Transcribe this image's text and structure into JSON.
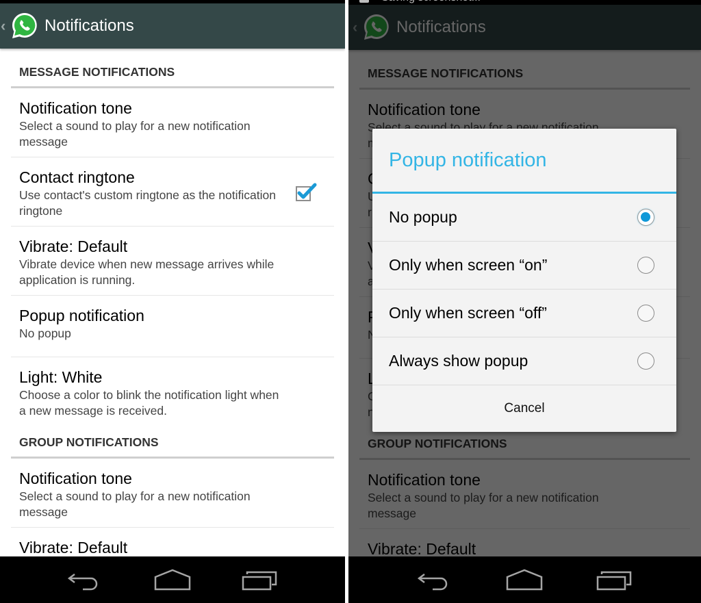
{
  "left": {
    "actionbar": {
      "title": "Notifications",
      "up_icon": "chevron-left-icon",
      "logo_icon": "whatsapp-logo-icon"
    },
    "categories": [
      {
        "title": "MESSAGE NOTIFICATIONS",
        "items": [
          {
            "title": "Notification tone",
            "summary": "Select a sound to play for a new notification message"
          },
          {
            "title": "Contact ringtone",
            "summary": "Use contact's custom ringtone as the notification ringtone",
            "checked": true
          },
          {
            "title": "Vibrate: Default",
            "summary": "Vibrate device when new message arrives while application is running."
          },
          {
            "title": "Popup notification",
            "summary": "No popup"
          },
          {
            "title": "Light: White",
            "summary": "Choose a color to blink the notification light when a new message is received."
          }
        ]
      },
      {
        "title": "GROUP NOTIFICATIONS",
        "items": [
          {
            "title": "Notification tone",
            "summary": "Select a sound to play for a new notification message"
          },
          {
            "title": "Vibrate: Default",
            "summary": ""
          }
        ]
      }
    ]
  },
  "right": {
    "statusbar": {
      "text": "Saving screenshot..."
    },
    "actionbar": {
      "title": "Notifications"
    },
    "categories": [
      {
        "title": "MESSAGE NOTIFICATIONS",
        "items": [
          {
            "title": "Notification tone",
            "summary": "Select a sound to play for a new notification message"
          },
          {
            "title": "Contact ringtone",
            "summary": "Use contact's custom ringtone as the notification ringtone",
            "checked": true
          },
          {
            "title": "Vibrate: Default",
            "summary": "Vibrate device when new message arrives while application is running."
          },
          {
            "title": "Popup notification",
            "summary": "No popup"
          },
          {
            "title": "Light: White",
            "summary": "Choose a color to blink the notification light when a new message is received."
          }
        ]
      },
      {
        "title": "GROUP NOTIFICATIONS",
        "items": [
          {
            "title": "Notification tone",
            "summary": "Select a sound to play for a new notification message"
          },
          {
            "title": "Vibrate: Default",
            "summary": ""
          }
        ]
      }
    ],
    "dialog": {
      "title": "Popup notification",
      "options": [
        {
          "label": "No popup",
          "selected": true
        },
        {
          "label": "Only when screen “on”",
          "selected": false
        },
        {
          "label": "Only when screen “off”",
          "selected": false
        },
        {
          "label": "Always show popup",
          "selected": false
        }
      ],
      "cancel_label": "Cancel"
    }
  },
  "navbar": {
    "back": "back-icon",
    "home": "home-icon",
    "recents": "recents-icon"
  },
  "colors": {
    "actionbar": "#344848",
    "accent": "#33b5e5",
    "radio_selected": "#0f98d8",
    "whatsapp_green": "#2fb541"
  }
}
